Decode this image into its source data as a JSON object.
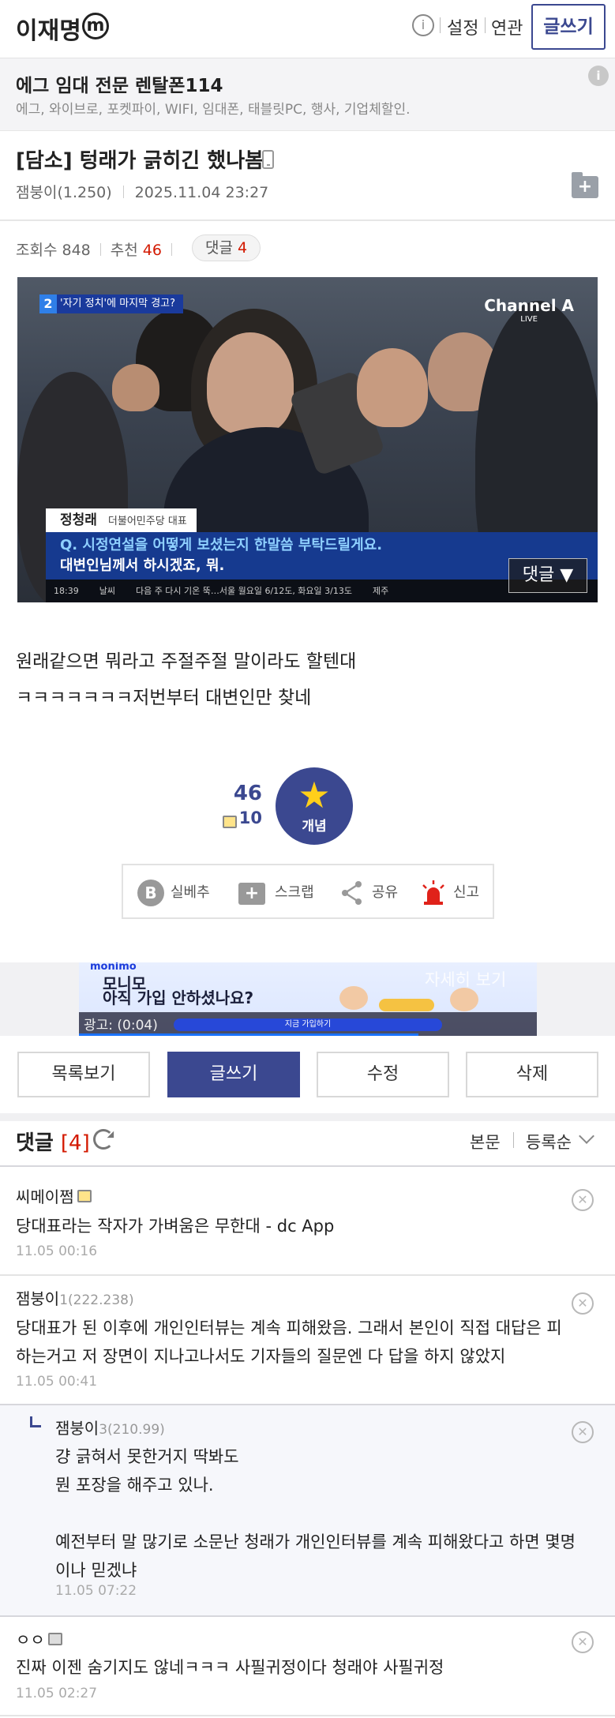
{
  "header": {
    "title": "이재명",
    "m_badge": "m",
    "info_glyph": "i",
    "settings_label": "설정",
    "related_label": "연관",
    "write_label": "글쓰기"
  },
  "ad": {
    "title": "에그 임대 전문 렌탈폰114",
    "desc": "에그, 와이브로, 포켓파이, WIFI, 임대폰, 태블릿PC, 행사, 기업체할인.",
    "info_glyph": "i"
  },
  "post": {
    "title": "[담소] 텅래가 긁히긴 했나봄",
    "author": "잼붕이(1.250)",
    "date": "2025.11.04 23:27",
    "views_label": "조회수",
    "views": "848",
    "recommend_label": "추천",
    "recommend": "46",
    "comments_label": "댓글",
    "comments": "4",
    "body_lines": [
      "원래같으면 뭐라고 주절주절 말이라도 할텐대",
      "ㅋㅋㅋㅋㅋㅋㅋ저번부터 대변인만 찾네"
    ]
  },
  "video": {
    "tag_num": "2",
    "tag_text": "'자기 정치'에 마지막 경고?",
    "logo": "Channel A",
    "logo_sub": "LIVE",
    "name": "정청래",
    "party": "더불어민주당 대표",
    "caption_line1": "Q. 시정연설을 어떻게 보셨는지 한말씀 부탁드릴게요.",
    "caption_line2": "대변인님께서 하시겠죠, 뭐.",
    "bottom_time": "18:39",
    "bottom_weather": "날씨",
    "bottom_ticker": "다음 주 다시 기온 뚝…서울 월요일 6/12도, 화요일 3/13도",
    "bottom_right": "제주",
    "comment_button": "댓글 ▼"
  },
  "recommend": {
    "count": "46",
    "fixed_count": "10",
    "button_label": "개념",
    "star_glyph": "★"
  },
  "tools": {
    "silbe": "실베추",
    "scrap": "스크랩",
    "share": "공유",
    "report": "신고",
    "b_glyph": "B",
    "plus_glyph": "+"
  },
  "ad2": {
    "logo": "monimo",
    "headline1": "모니모",
    "headline2": "아직 가입 안하셨나요?",
    "see_more": "자세히 보기",
    "time": "광고: (0:04)",
    "cta": "지금 가입하기"
  },
  "actions": {
    "list": "목록보기",
    "write": "글쓰기",
    "edit": "수정",
    "delete": "삭제"
  },
  "comments_header": {
    "title": "댓글",
    "count": "[4]",
    "opt_body": "본문",
    "opt_sort": "등록순"
  },
  "comments": [
    {
      "nick": "씨메이쩜",
      "ip": "",
      "text": [
        "당대표라는 작자가 가벼움은 무한대 - dc App"
      ],
      "time": "11.05 00:16"
    },
    {
      "nick": "잼붕이",
      "ip": "1(222.238)",
      "text": [
        "당대표가 된 이후에 개인인터뷰는 계속 피해왔음. 그래서 본인이 직접 대답은 피",
        "하는거고 저 장면이 지나고나서도 기자들의 질문엔 다 답을 하지 않았지"
      ],
      "time": "11.05 00:41"
    },
    {
      "nick": "잼붕이",
      "ip": "3(210.99)",
      "text": [
        "걍 긁혀서 못한거지 딱봐도",
        "뭔 포장을 해주고 있나.",
        "",
        "예전부터 말 많기로 소문난 청래가 개인인터뷰를 계속 피해왔다고 하면 몇명",
        "이나 믿겠냐"
      ],
      "time": "11.05 07:22"
    },
    {
      "nick": "ㅇㅇ",
      "ip": "",
      "text": [
        "진짜 이젠 숨기지도 않네ㅋㅋㅋ 사필귀정이다 청래야 사필귀정"
      ],
      "time": "11.05 02:27"
    }
  ],
  "delete_glyph": "✕"
}
